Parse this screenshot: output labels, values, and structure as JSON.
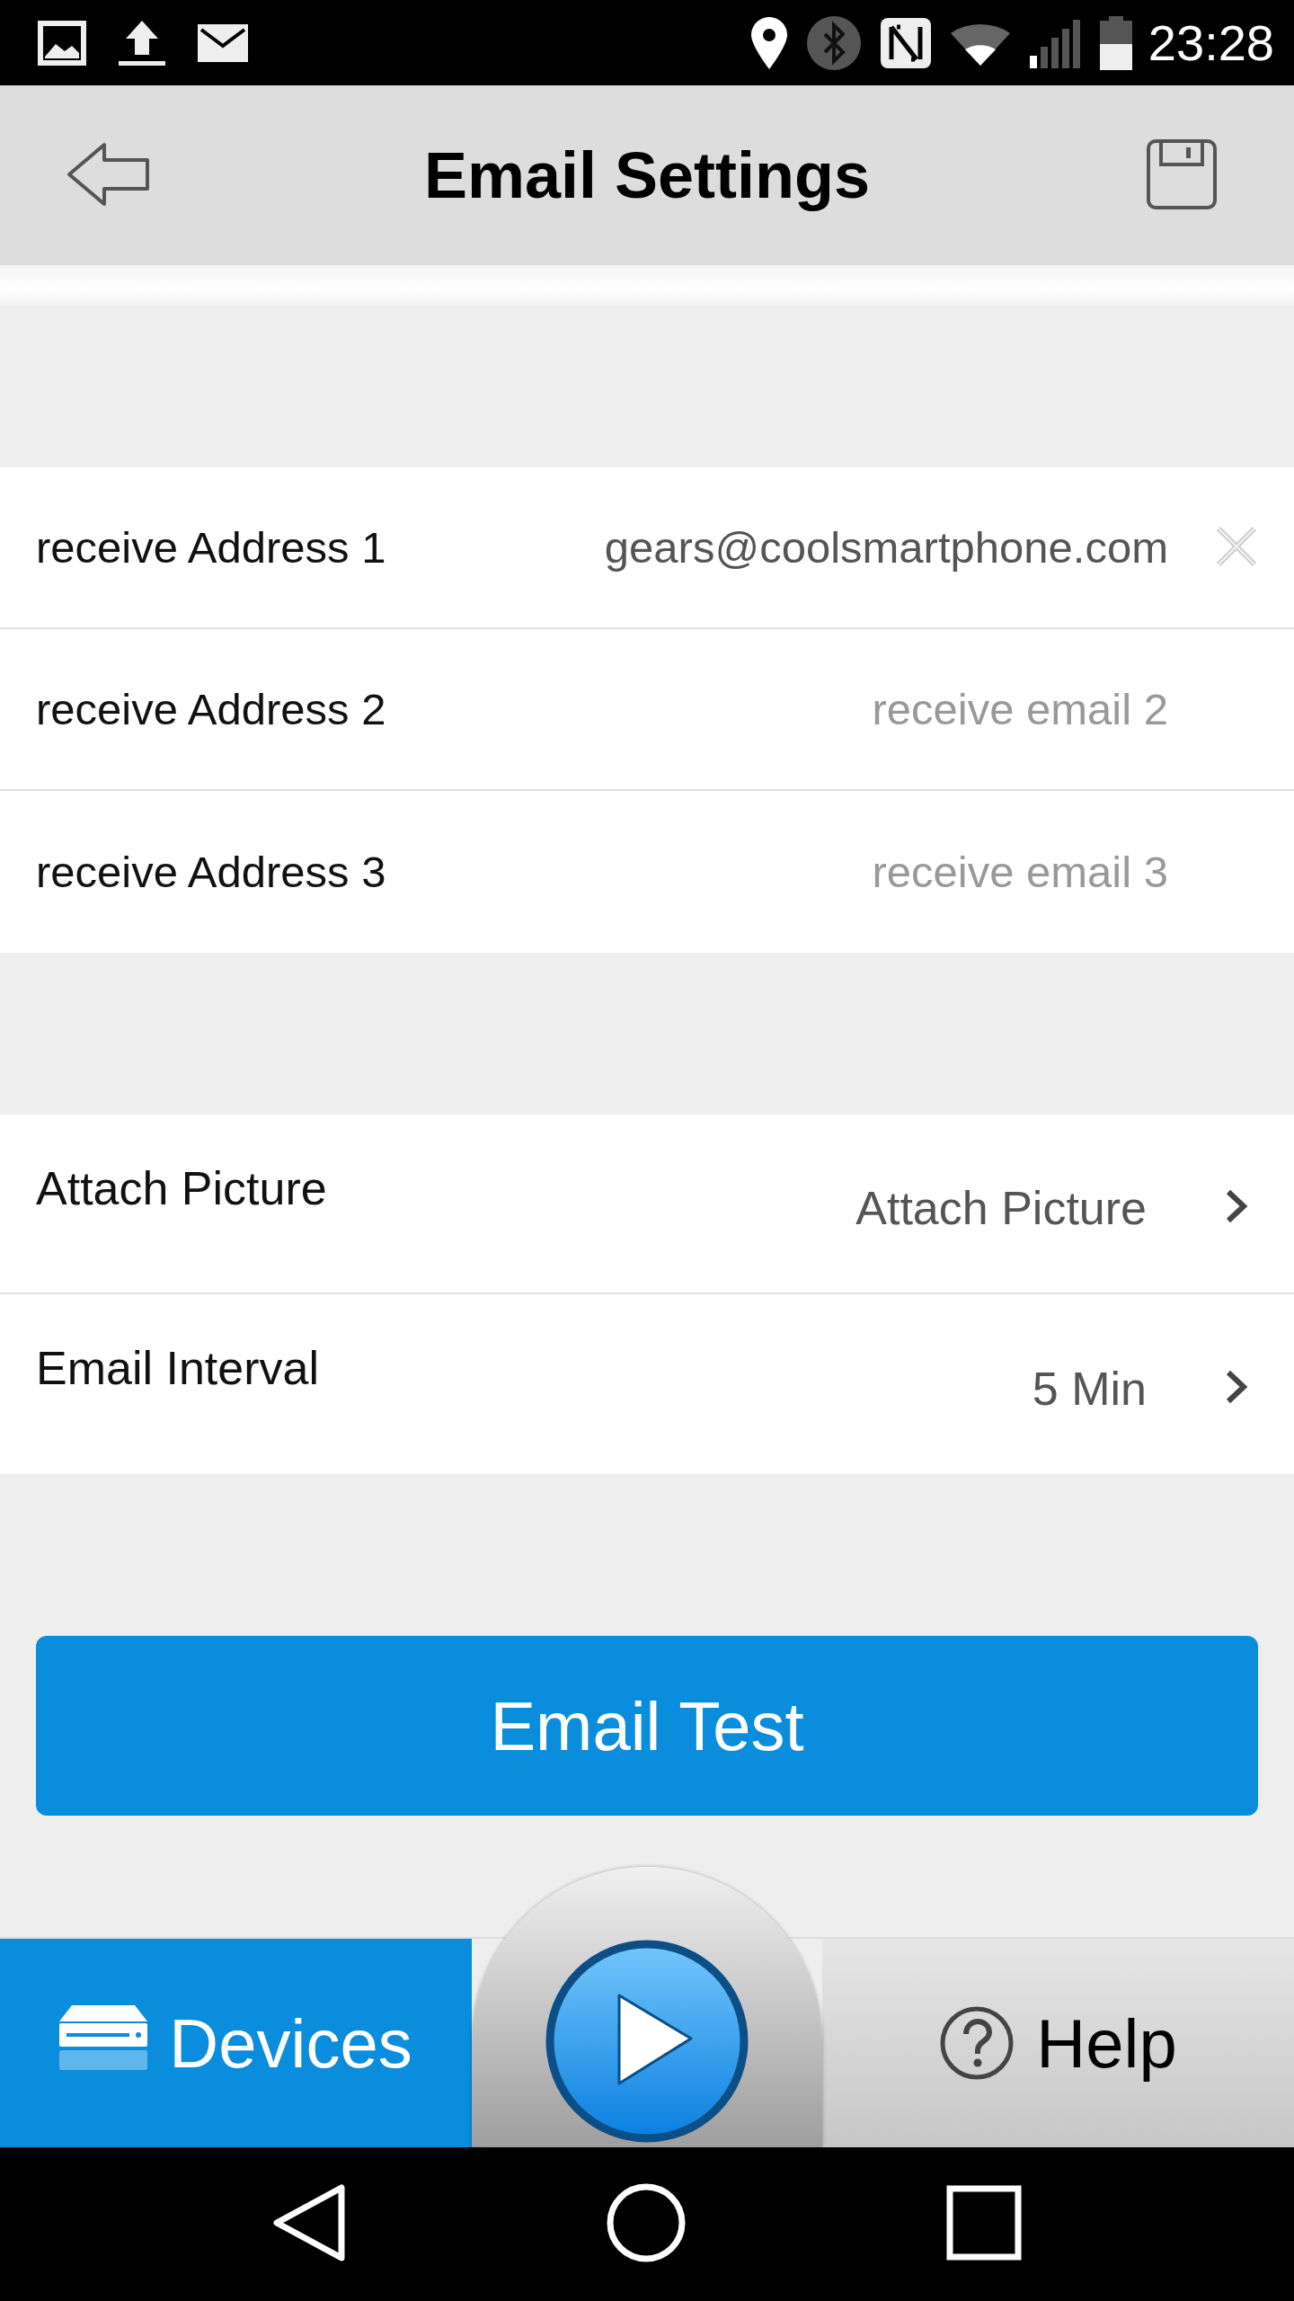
{
  "status_bar": {
    "time": "23:28"
  },
  "header": {
    "title": "Email Settings"
  },
  "address_rows": [
    {
      "label": "receive Address 1",
      "value": "gears@coolsmartphone.com"
    },
    {
      "label": "receive Address 2",
      "placeholder": "receive email 2"
    },
    {
      "label": "receive Address 3",
      "placeholder": "receive email 3"
    }
  ],
  "option_rows": [
    {
      "label": "Attach Picture",
      "value": "Attach Picture"
    },
    {
      "label": "Email Interval",
      "value": "5 Min"
    }
  ],
  "test_button": {
    "label": "Email Test"
  },
  "tab_bar": {
    "tabs": [
      {
        "kind": "devices",
        "label": "Devices",
        "selected": true
      },
      {
        "kind": "help",
        "label": "Help",
        "selected": false
      }
    ]
  }
}
